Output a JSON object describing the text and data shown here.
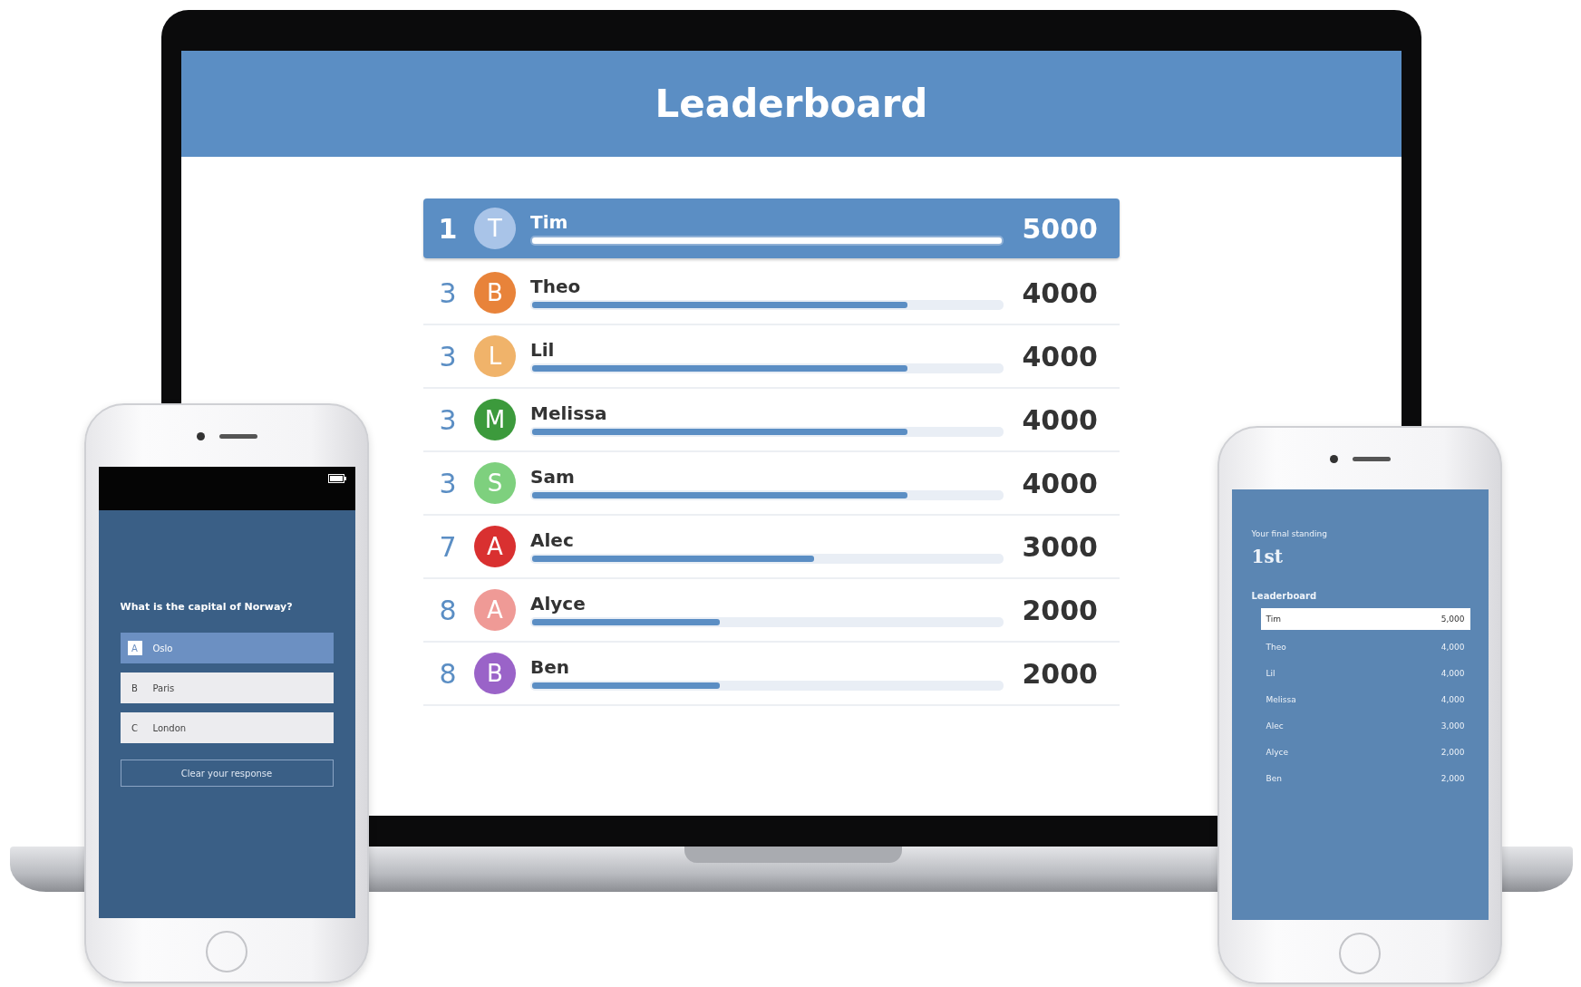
{
  "laptop": {
    "title": "Leaderboard",
    "rows": [
      {
        "rank": "1",
        "initial": "T",
        "name": "Tim",
        "score": "5000",
        "level": 1,
        "color": "#a9c4e8",
        "selected": true
      },
      {
        "rank": "3",
        "initial": "B",
        "name": "Theo",
        "score": "4000",
        "level": 0.8,
        "color": "#e8833a",
        "selected": false
      },
      {
        "rank": "3",
        "initial": "L",
        "name": "Lil",
        "score": "4000",
        "level": 0.8,
        "color": "#f0b36a",
        "selected": false
      },
      {
        "rank": "3",
        "initial": "M",
        "name": "Melissa",
        "score": "4000",
        "level": 0.8,
        "color": "#3c9a3c",
        "selected": false
      },
      {
        "rank": "3",
        "initial": "S",
        "name": "Sam",
        "score": "4000",
        "level": 0.8,
        "color": "#7ed07e",
        "selected": false
      },
      {
        "rank": "7",
        "initial": "A",
        "name": "Alec",
        "score": "3000",
        "level": 0.6,
        "color": "#d93030",
        "selected": false
      },
      {
        "rank": "8",
        "initial": "A",
        "name": "Alyce",
        "score": "2000",
        "level": 0.4,
        "color": "#ef9a96",
        "selected": false
      },
      {
        "rank": "8",
        "initial": "B",
        "name": "Ben",
        "score": "2000",
        "level": 0.4,
        "color": "#9a63c8",
        "selected": false
      }
    ]
  },
  "left_phone": {
    "question": "What is the capital of Norway?",
    "options": [
      {
        "letter": "A",
        "label": "Oslo",
        "selected": true
      },
      {
        "letter": "B",
        "label": "Paris",
        "selected": false
      },
      {
        "letter": "C",
        "label": "London",
        "selected": false
      }
    ],
    "button": "Clear your response"
  },
  "right_phone": {
    "caption": "Your final standing",
    "place": "1st",
    "heading": "Leaderboard",
    "rows": [
      {
        "name": "Tim",
        "score": "5,000",
        "selected": true
      },
      {
        "name": "Theo",
        "score": "4,000",
        "selected": false
      },
      {
        "name": "Lil",
        "score": "4,000",
        "selected": false
      },
      {
        "name": "Melissa",
        "score": "4,000",
        "selected": false
      },
      {
        "name": "Alec",
        "score": "3,000",
        "selected": false
      },
      {
        "name": "Alyce",
        "score": "2,000",
        "selected": false
      },
      {
        "name": "Ben",
        "score": "2,000",
        "selected": false
      }
    ]
  }
}
